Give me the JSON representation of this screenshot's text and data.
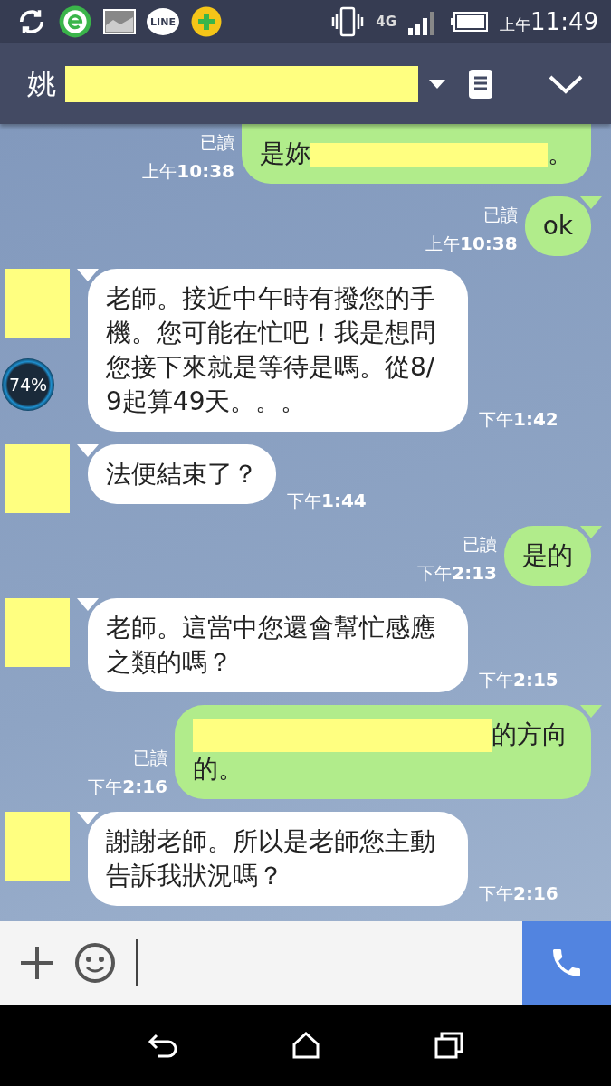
{
  "status_bar": {
    "app_badge": "LINE",
    "network": "4G",
    "period": "上午",
    "time": "11:49"
  },
  "header": {
    "name": "姚",
    "name_redacted": true
  },
  "messages": [
    {
      "kind": "outgoing",
      "cut": true,
      "parts": [
        {
          "kind": "text",
          "text": "是妳"
        },
        {
          "kind": "redacted"
        },
        {
          "kind": "text",
          "text": "。"
        }
      ],
      "read_label": "已讀",
      "period": "上午",
      "time": "10:38"
    },
    {
      "kind": "outgoing",
      "parts": [
        {
          "kind": "text",
          "text": "ok"
        }
      ],
      "read_label": "已讀",
      "period": "上午",
      "time": "10:38"
    },
    {
      "kind": "incoming",
      "parts": [
        {
          "kind": "text",
          "text": "老師。接近中午時有撥您的手機。您可能在忙吧！我是想問您接下來就是等待是嗎。從8/9起算49天。。。"
        }
      ],
      "period": "下午",
      "time": "1:42"
    },
    {
      "kind": "incoming",
      "parts": [
        {
          "kind": "text",
          "text": "法便結束了？"
        }
      ],
      "period": "下午",
      "time": "1:44"
    },
    {
      "kind": "outgoing",
      "parts": [
        {
          "kind": "text",
          "text": "是的"
        }
      ],
      "read_label": "已讀",
      "period": "下午",
      "time": "2:13"
    },
    {
      "kind": "incoming",
      "parts": [
        {
          "kind": "text",
          "text": "老師。這當中您還會幫忙感應之類的嗎？"
        }
      ],
      "period": "下午",
      "time": "2:15"
    },
    {
      "kind": "outgoing",
      "parts": [
        {
          "kind": "redacted_line"
        },
        {
          "kind": "text",
          "text": "的方向的。"
        }
      ],
      "read_label": "已讀",
      "period": "下午",
      "time": "2:16"
    },
    {
      "kind": "incoming",
      "parts": [
        {
          "kind": "text",
          "text": "謝謝老師。所以是老師您主動告訴我狀況嗎？"
        }
      ],
      "period": "下午",
      "time": "2:16"
    }
  ],
  "floating_widget": {
    "label": "74%"
  }
}
